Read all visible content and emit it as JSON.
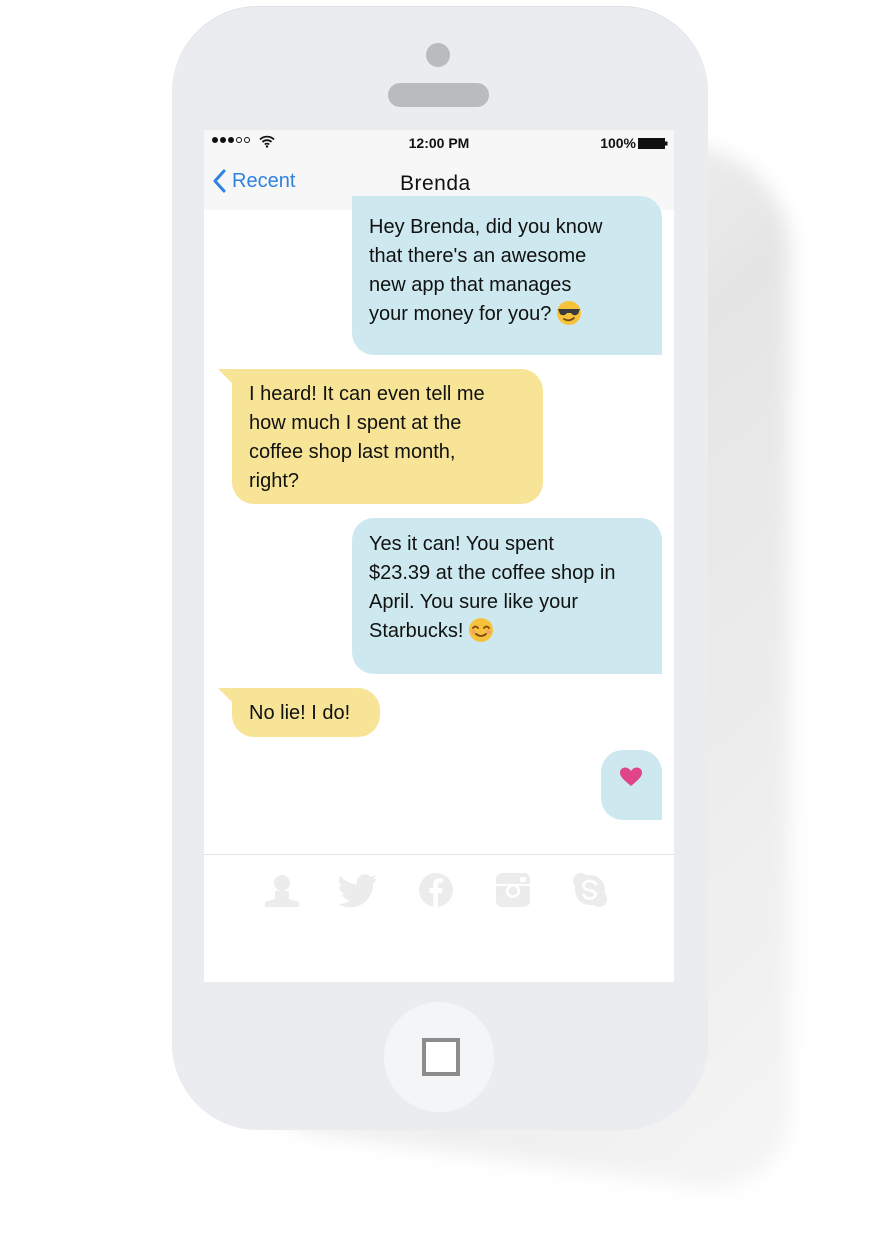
{
  "status_bar": {
    "time": "12:00 PM",
    "battery": "100%"
  },
  "nav": {
    "back_label": "Recent",
    "title": "Brenda"
  },
  "messages": [
    {
      "direction": "out",
      "text": "Hey Brenda, did you know that there's an awesome new app that manages your money for you?",
      "lines": [
        "Hey Brenda, did you know",
        "that there's an awesome",
        "new app that manages",
        "your money for you?"
      ],
      "emoji": "sunglasses-emoji"
    },
    {
      "direction": "in",
      "text": "I heard! It can even tell me how much I spent at the coffee shop last month, right?",
      "lines": [
        "I heard! It can even tell me",
        "how much I spent at the",
        "coffee shop last month,",
        "right?"
      ]
    },
    {
      "direction": "out",
      "text": "Yes it can! You spent $23.39 at the coffee shop in April. You sure like your Starbucks!",
      "lines": [
        "Yes it can! You spent",
        "$23.39 at the coffee shop in",
        "April. You sure like your",
        "Starbucks!"
      ],
      "emoji": "smiling-emoji"
    },
    {
      "direction": "in",
      "text": "No lie! I do!",
      "lines": [
        "No lie! I do!"
      ]
    },
    {
      "direction": "out",
      "text": "",
      "emoji": "heart-icon"
    }
  ],
  "tab_icons": [
    "person-icon",
    "twitter-icon",
    "facebook-icon",
    "instagram-icon",
    "skype-icon"
  ],
  "colors": {
    "outgoing_bubble": "#cde9ef",
    "incoming_bubble": "#f7e496",
    "accent_blue": "#2f82e0",
    "heart": "#e0458a",
    "phone_body": "#eaecef"
  }
}
